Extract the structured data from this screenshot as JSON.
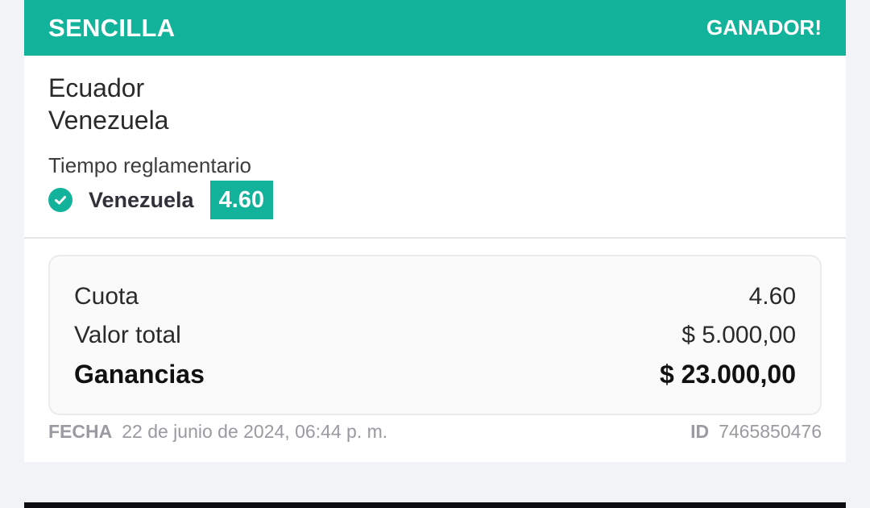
{
  "header": {
    "bet_type": "SENCILLA",
    "result_status": "GANADOR!"
  },
  "match": {
    "home_team": "Ecuador",
    "away_team": "Venezuela"
  },
  "selection": {
    "market": "Tiempo reglamentario",
    "pick": "Venezuela",
    "odds": "4.60",
    "status_icon": "check-circle-icon"
  },
  "summary": {
    "odds_label": "Cuota",
    "odds_value": "4.60",
    "stake_label": "Valor total",
    "stake_value": "$ 5.000,00",
    "winnings_label": "Ganancias",
    "winnings_value": "$ 23.000,00"
  },
  "footer": {
    "date_label": "FECHA",
    "date_value": "22 de junio de 2024, 06:44 p. m.",
    "id_label": "ID",
    "id_value": "7465850476"
  },
  "colors": {
    "accent": "#12b39a"
  }
}
